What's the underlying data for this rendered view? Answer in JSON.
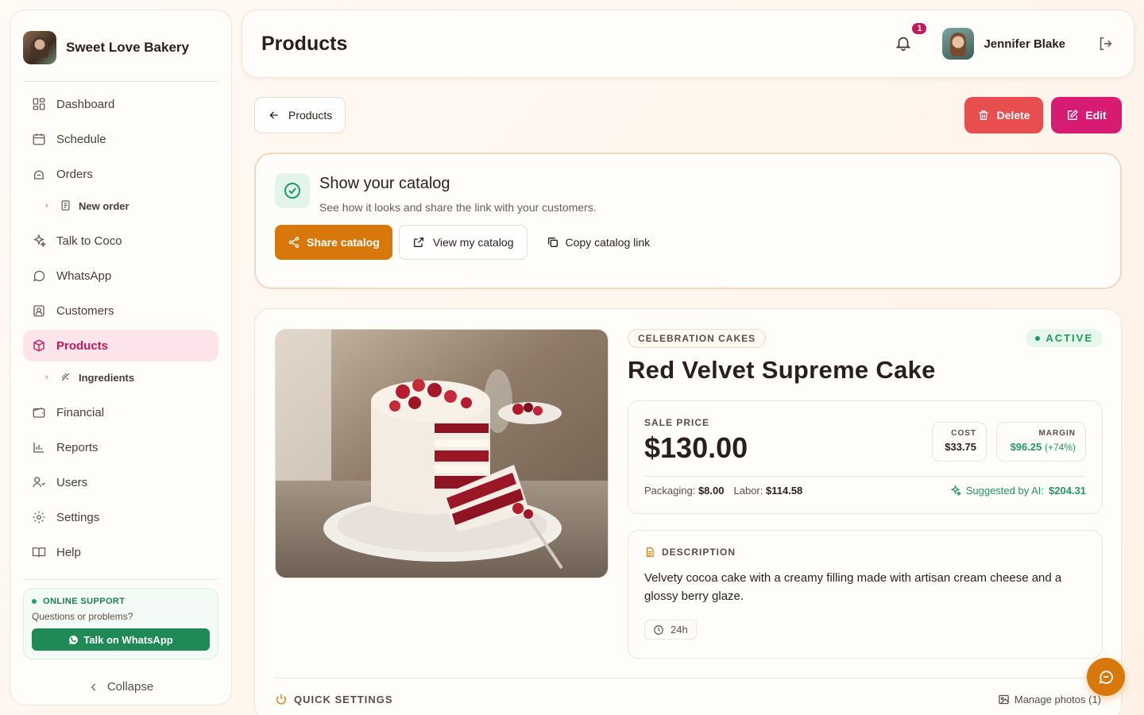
{
  "brand": {
    "name": "Sweet Love Bakery"
  },
  "sidebar": {
    "items": [
      {
        "label": "Dashboard",
        "icon": "dashboard-icon"
      },
      {
        "label": "Schedule",
        "icon": "calendar-icon"
      },
      {
        "label": "Orders",
        "icon": "orders-icon"
      },
      {
        "label": "Talk to Coco",
        "icon": "sparkles-icon"
      },
      {
        "label": "WhatsApp",
        "icon": "chat-icon"
      },
      {
        "label": "Customers",
        "icon": "customers-icon"
      },
      {
        "label": "Products",
        "icon": "box-icon"
      },
      {
        "label": "Financial",
        "icon": "wallet-icon"
      },
      {
        "label": "Reports",
        "icon": "bar-chart-icon"
      },
      {
        "label": "Users",
        "icon": "users-icon"
      },
      {
        "label": "Settings",
        "icon": "gear-icon"
      },
      {
        "label": "Help",
        "icon": "book-icon"
      }
    ],
    "sub_new_order": "New order",
    "sub_ingredients": "Ingredients",
    "support_title": "ONLINE SUPPORT",
    "support_sub": "Questions or problems?",
    "support_button": "Talk on WhatsApp",
    "collapse": "Collapse"
  },
  "header": {
    "title": "Products",
    "notifications": "1",
    "user_name": "Jennifer Blake"
  },
  "actions": {
    "back": "Products",
    "delete": "Delete",
    "edit": "Edit"
  },
  "catalog": {
    "title": "Show your catalog",
    "subtitle": "See how it looks and share the link with your customers.",
    "share": "Share catalog",
    "view": "View my catalog",
    "copy": "Copy catalog link"
  },
  "product": {
    "category": "CELEBRATION CAKES",
    "status": "ACTIVE",
    "name": "Red Velvet Supreme Cake",
    "sale_price_label": "SALE PRICE",
    "sale_price": "$130.00",
    "cost_label": "COST",
    "cost": "$33.75",
    "margin_label": "MARGIN",
    "margin": "$96.25",
    "margin_pct": "(+74%)",
    "packaging_label": "Packaging:",
    "packaging": "$8.00",
    "labor_label": "Labor:",
    "labor": "$114.58",
    "ai_label": "Suggested by AI:",
    "ai_price": "$204.31",
    "description_label": "DESCRIPTION",
    "description": "Velvety cocoa cake with a creamy filling made with artisan cream cheese and a glossy berry glaze.",
    "prep_time": "24h",
    "quick_settings": "QUICK SETTINGS",
    "manage_photos": "Manage photos (1)"
  },
  "colors": {
    "accent": "#d9780a",
    "brand_pink": "#d81b72",
    "danger": "#e94e4e",
    "success": "#1f9a5d"
  }
}
